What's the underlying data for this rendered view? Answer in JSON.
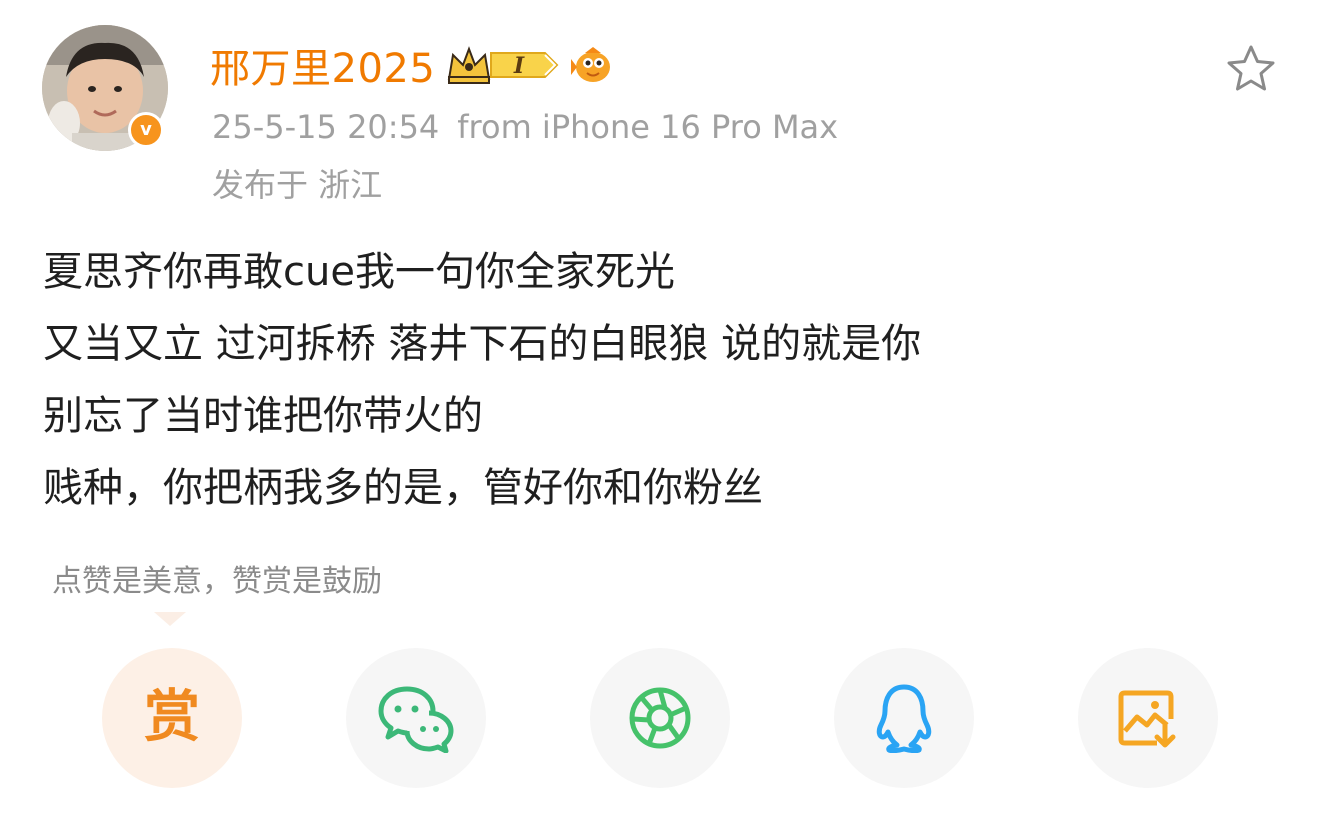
{
  "post": {
    "author": {
      "name": "邢万里2025",
      "vip_level": "I",
      "verified_icon": "v"
    },
    "timestamp": "25-5-15 20:54",
    "source": "from iPhone 16 Pro Max",
    "location": "发布于 浙江",
    "content_lines": [
      "夏思齐你再敢cue我一句你全家死光",
      "又当又立 过河拆桥 落井下石的白眼狼 说的就是你",
      "别忘了当时谁把你带火的",
      "贱种，你把柄我多的是，管好你和你粉丝"
    ]
  },
  "reward": {
    "hint": "点赞是美意，赞赏是鼓励",
    "button_label": "赏"
  },
  "share_buttons": [
    {
      "name": "reward",
      "icon": "reward-icon",
      "color": "#f08a20"
    },
    {
      "name": "wechat",
      "icon": "wechat-icon",
      "color": "#3cb878"
    },
    {
      "name": "moments",
      "icon": "moments-icon",
      "color": "#46c26a"
    },
    {
      "name": "qq",
      "icon": "qq-icon",
      "color": "#2aa4f4"
    },
    {
      "name": "save-image",
      "icon": "save-image-icon",
      "color": "#f5a623"
    }
  ],
  "colors": {
    "username": "#f07a00",
    "meta": "#a0a0a0",
    "verified": "#f7941d"
  }
}
